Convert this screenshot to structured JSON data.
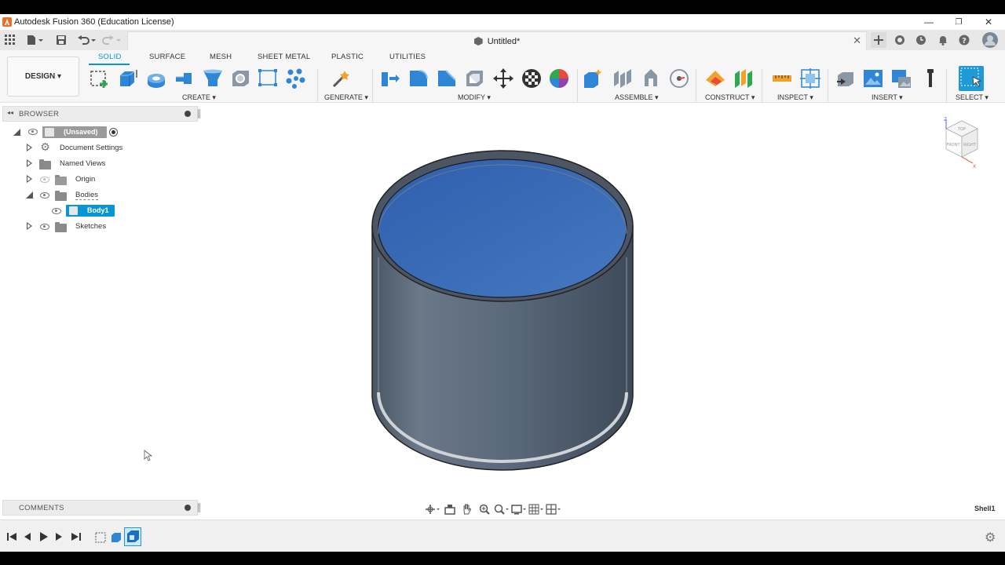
{
  "window": {
    "title": "Autodesk Fusion 360 (Education License)",
    "controls": {
      "minimize": "—",
      "restore": "❐",
      "close": "✕"
    }
  },
  "quick_access": {
    "grid_icon": "grid-icon",
    "file_icon": "file-icon",
    "save_icon": "save-icon",
    "undo_icon": "undo-icon",
    "redo_icon": "redo-icon"
  },
  "document_tab": {
    "title": "Untitled*",
    "close": "✕"
  },
  "right_icons": [
    "new-tab-icon",
    "extensions-icon",
    "job-status-icon",
    "notifications-icon",
    "help-icon",
    "user-avatar"
  ],
  "workspace": {
    "label": "DESIGN ▾"
  },
  "tabs": [
    "SOLID",
    "SURFACE",
    "MESH",
    "SHEET METAL",
    "PLASTIC",
    "UTILITIES"
  ],
  "active_tab": "SOLID",
  "groups": {
    "create": "CREATE ▾",
    "generate": "GENERATE ▾",
    "modify": "MODIFY ▾",
    "assemble": "ASSEMBLE ▾",
    "construct": "CONSTRUCT ▾",
    "inspect": "INSPECT ▾",
    "insert": "INSERT ▾",
    "select": "SELECT ▾"
  },
  "browser": {
    "title": "BROWSER",
    "root": "(Unsaved)",
    "items": {
      "document_settings": "Document Settings",
      "named_views": "Named Views",
      "origin": "Origin",
      "bodies": "Bodies",
      "body1": "Body1",
      "sketches": "Sketches"
    }
  },
  "comments": {
    "title": "COMMENTS"
  },
  "viewcube": {
    "top": "TOP",
    "front": "FRONT",
    "right": "RIGHT",
    "axis_z": "Z",
    "axis_x": "X"
  },
  "status": {
    "active_feature": "Shell1"
  },
  "colors": {
    "accent": "#0696d7",
    "body_side": "#5c6b7d",
    "body_inner": "#3a6bb6"
  }
}
